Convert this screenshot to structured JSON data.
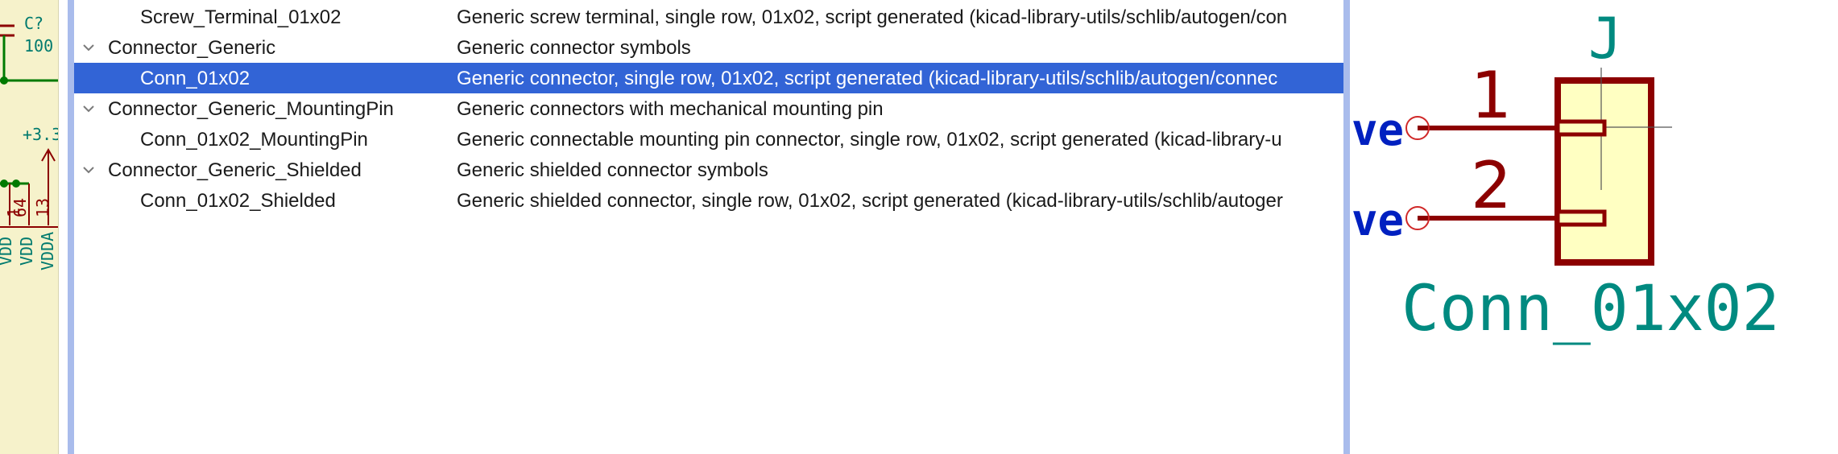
{
  "schematic": {
    "cap_ref": "C?",
    "cap_value": "100",
    "power_label": "+3.3",
    "pin_numbers": [
      "1",
      "64",
      "13"
    ],
    "pin_names": [
      "VDD",
      "VDD",
      "VDDA"
    ]
  },
  "tree": {
    "rows": [
      {
        "type": "item",
        "name": "Screw_Terminal_01x02",
        "desc": "Generic screw terminal, single row, 01x02, script generated (kicad-library-utils/schlib/autogen/con",
        "selected": false
      },
      {
        "type": "group",
        "name": "Connector_Generic",
        "desc": "Generic connector symbols",
        "selected": false
      },
      {
        "type": "item",
        "name": "Conn_01x02",
        "desc": "Generic connector, single row, 01x02, script generated (kicad-library-utils/schlib/autogen/connec",
        "selected": true
      },
      {
        "type": "group",
        "name": "Connector_Generic_MountingPin",
        "desc": "Generic connectors with mechanical mounting pin",
        "selected": false
      },
      {
        "type": "item",
        "name": "Conn_01x02_MountingPin",
        "desc": "Generic connectable mounting pin connector, single row, 01x02, script generated (kicad-library-u",
        "selected": false
      },
      {
        "type": "group",
        "name": "Connector_Generic_Shielded",
        "desc": "Generic shielded connector symbols",
        "selected": false
      },
      {
        "type": "item",
        "name": "Conn_01x02_Shielded",
        "desc": "Generic shielded connector, single row, 01x02, script generated (kicad-library-utils/schlib/autoger",
        "selected": false
      }
    ]
  },
  "preview": {
    "reference": "J",
    "value": "Conn_01x02",
    "pin1_number": "1",
    "pin2_number": "2",
    "net_label_1": "ve",
    "net_label_2": "ve"
  },
  "colors": {
    "selection": "#3264d6",
    "divider": "#a9bcec",
    "schematic_bg": "#f6f2cb",
    "symbol_body_fill": "#ffffc2",
    "symbol_outline": "#8c0000",
    "field_text": "#008a80",
    "net_text": "#0020c0"
  }
}
